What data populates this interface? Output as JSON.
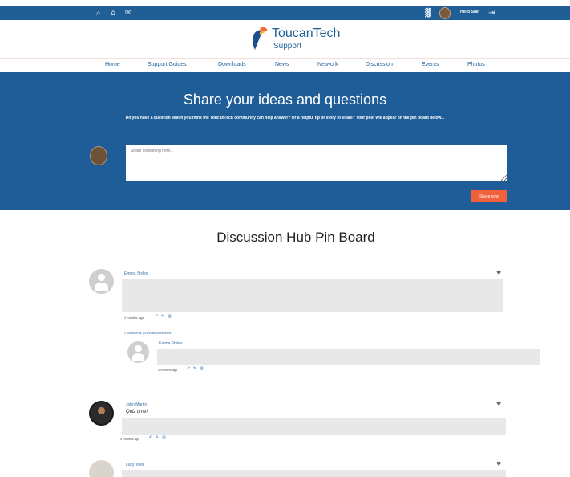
{
  "header": {
    "search_icon": "search-icon",
    "bell_icon": "bell-icon",
    "mail_icon": "mail-icon",
    "chart_icon": "chart-icon",
    "user_greeting": "Hello Sian",
    "logout_icon": "logout-icon"
  },
  "logo": {
    "title": "ToucanTech",
    "subtitle": "Support"
  },
  "nav": {
    "items": [
      "Home",
      "Support Guides",
      "Downloads",
      "News",
      "Network",
      "Discussion",
      "Events",
      "Photos"
    ]
  },
  "hero": {
    "title": "Share your ideas and questions",
    "description": "Do you have a question which you think the ToucanTech community can help answer? Or a helpful tip or story to share? Your post will appear on the pin board below...",
    "placeholder": "Share something here...",
    "share_button": "Share now"
  },
  "board": {
    "title": "Discussion Hub Pin Board",
    "posts": [
      {
        "name": "Emma Styles",
        "time": "2 months ago",
        "comments": "2 comments | View all comments"
      },
      {
        "name": "Emma Styles",
        "time": "2 months ago"
      },
      {
        "name": "John Martin",
        "quote": "Quiz time!",
        "time": "4 months ago"
      },
      {
        "name": "Lucy Toler"
      }
    ]
  },
  "colors": {
    "brand": "#1e5d97",
    "accent": "#f1603a"
  }
}
